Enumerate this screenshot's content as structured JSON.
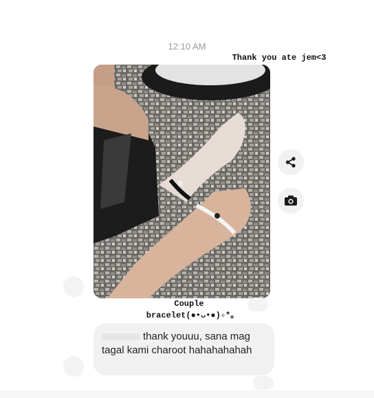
{
  "chat": {
    "timestamp": "12:10 AM",
    "top_caption": "Thank you ate jem<3",
    "photo_caption_line1": "Couple",
    "photo_caption_line2": "bracelet(●•ᴗ•●)✧*。",
    "message_text": "thank youuu, sana mag tagal kami charoot hahahahahah"
  },
  "icons": {
    "share": "share-icon",
    "camera": "camera-icon"
  }
}
